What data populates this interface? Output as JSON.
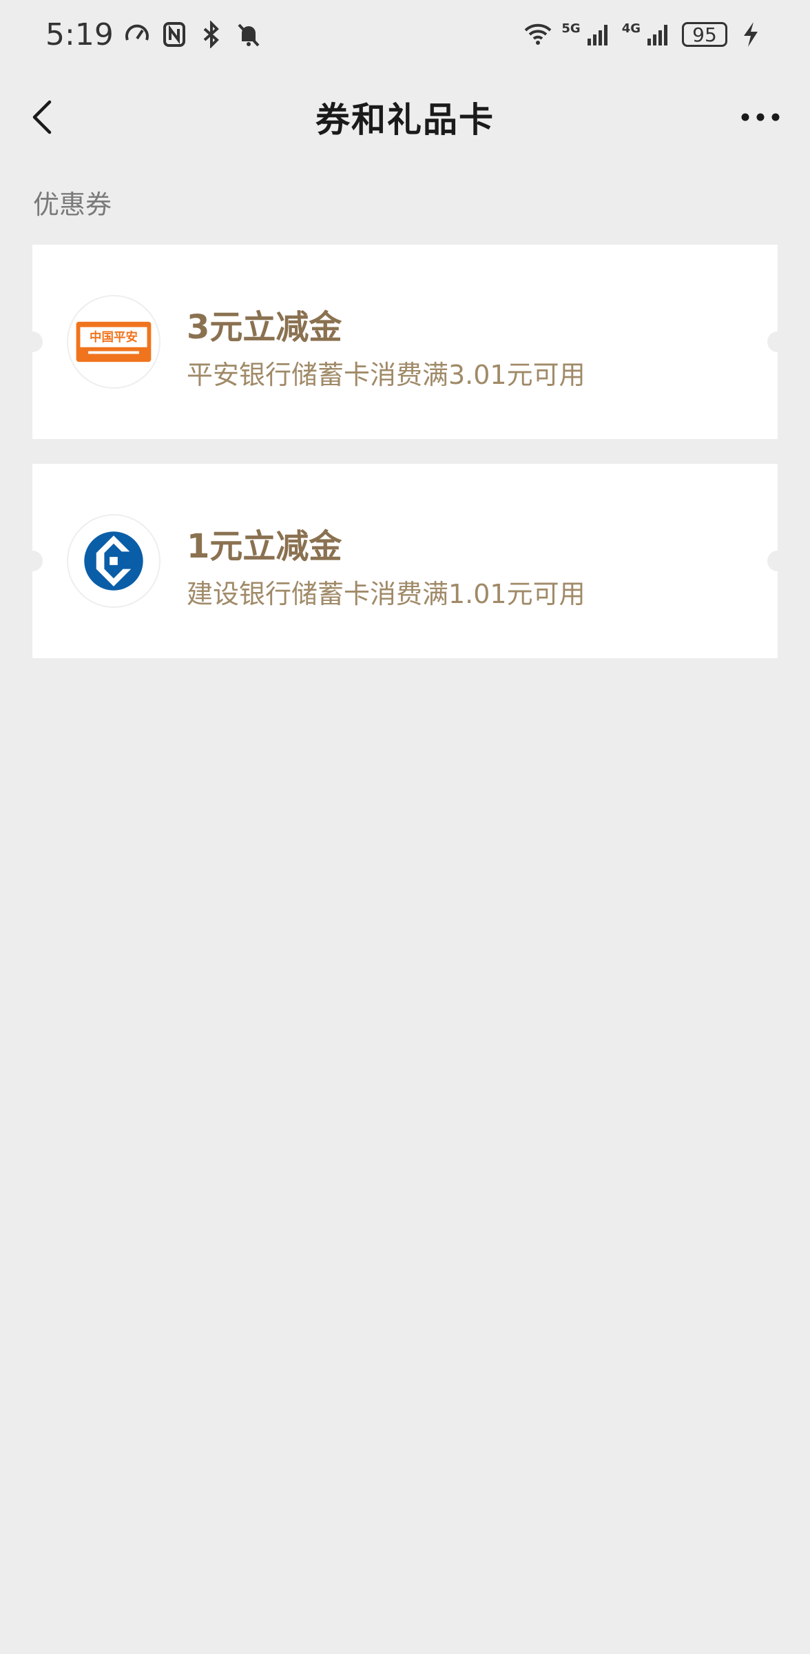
{
  "status_bar": {
    "time": "5:19",
    "battery": "95",
    "network_5g": "5G",
    "network_4g": "4G"
  },
  "nav": {
    "title": "券和礼品卡"
  },
  "section": {
    "label": "优惠券"
  },
  "coupons": [
    {
      "title": "3元立减金",
      "description": "平安银行储蓄卡消费满3.01元可用",
      "logo": "ping-an-bank-logo",
      "logo_text": "中国平安"
    },
    {
      "title": "1元立减金",
      "description": "建设银行储蓄卡消费满1.01元可用",
      "logo": "ccb-logo"
    }
  ],
  "colors": {
    "background": "#ededed",
    "card": "#ffffff",
    "coupon_title": "#8a7150",
    "coupon_desc": "#a08a68",
    "ping_an_orange": "#f0741e",
    "ccb_blue": "#0a5ea8"
  }
}
